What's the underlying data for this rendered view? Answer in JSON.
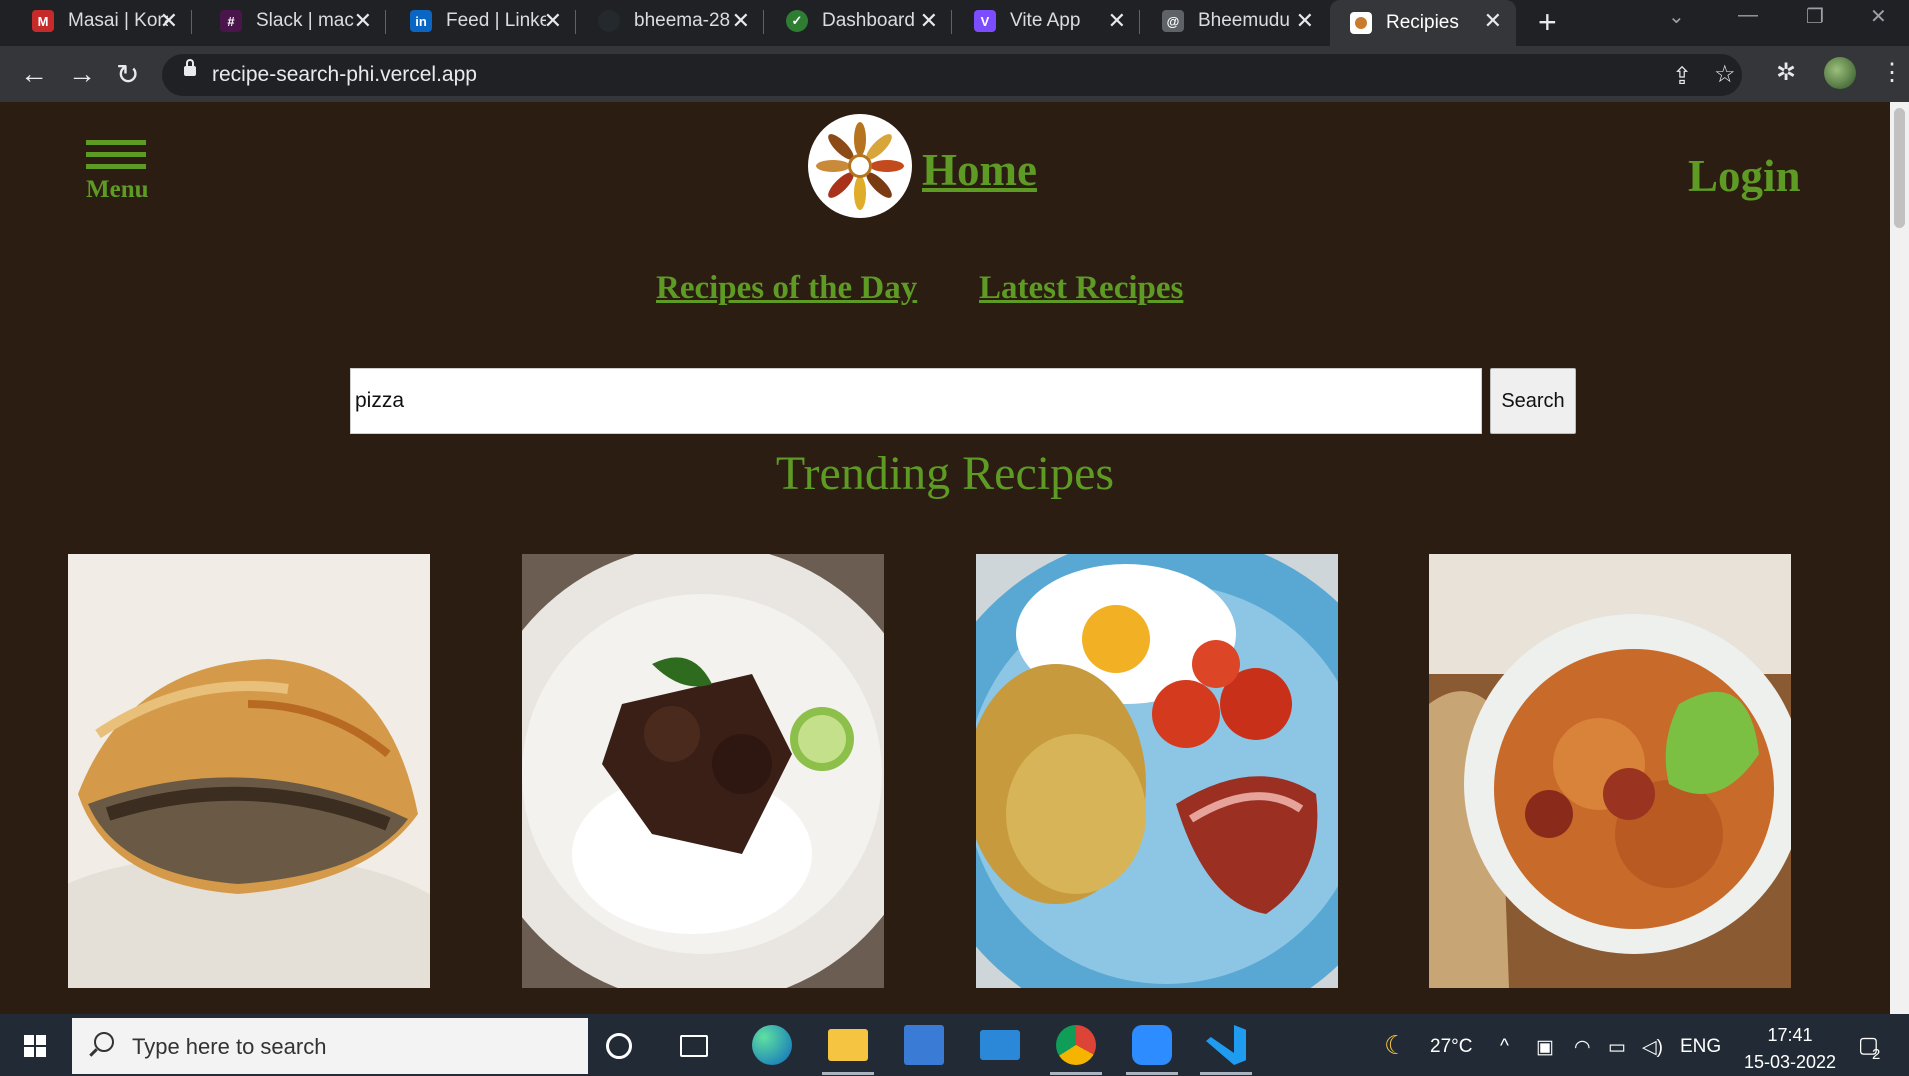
{
  "browser": {
    "tabs": [
      {
        "title": "Masai | Kora",
        "color": "#c62b2b"
      },
      {
        "title": "Slack | mac",
        "color": "#4a154b"
      },
      {
        "title": "Feed | Linke",
        "color": "#0a66c2"
      },
      {
        "title": "bheema-28",
        "color": "#24292e"
      },
      {
        "title": "Dashboard",
        "color": "#2e7d32"
      },
      {
        "title": "Vite App",
        "color": "#7c4dff"
      },
      {
        "title": "Bheemudu",
        "color": "#5f6368"
      },
      {
        "title": "Recipies",
        "color": "#c97b2d"
      }
    ],
    "url": "recipe-search-phi.vercel.app"
  },
  "header": {
    "menu_label": "Menu",
    "home_label": "Home",
    "login_label": "Login"
  },
  "subnav": {
    "recipes_of_day": "Recipes of the Day",
    "latest_recipes": "Latest Recipes"
  },
  "search": {
    "value": "pizza",
    "button_label": "Search"
  },
  "trending": {
    "title": "Trending Recipes",
    "cards": [
      {
        "name": "meat-pie-image",
        "colors": [
          "#f1ede6",
          "#c98a3a"
        ]
      },
      {
        "name": "beef-rice-image",
        "colors": [
          "#e9e6e1",
          "#3a1f16"
        ]
      },
      {
        "name": "breakfast-plate-image",
        "colors": [
          "#59a8d3",
          "#c79a3e"
        ]
      },
      {
        "name": "sauerkraut-stew-image",
        "colors": [
          "#c8b39a",
          "#c76a2a"
        ]
      }
    ]
  },
  "taskbar": {
    "search_placeholder": "Type here to search",
    "weather": "27°C",
    "language": "ENG",
    "time": "17:41",
    "date": "15-03-2022",
    "notifications": "2"
  },
  "theme": {
    "background": "#2b1d11",
    "accent_green": "#5e9b25"
  }
}
